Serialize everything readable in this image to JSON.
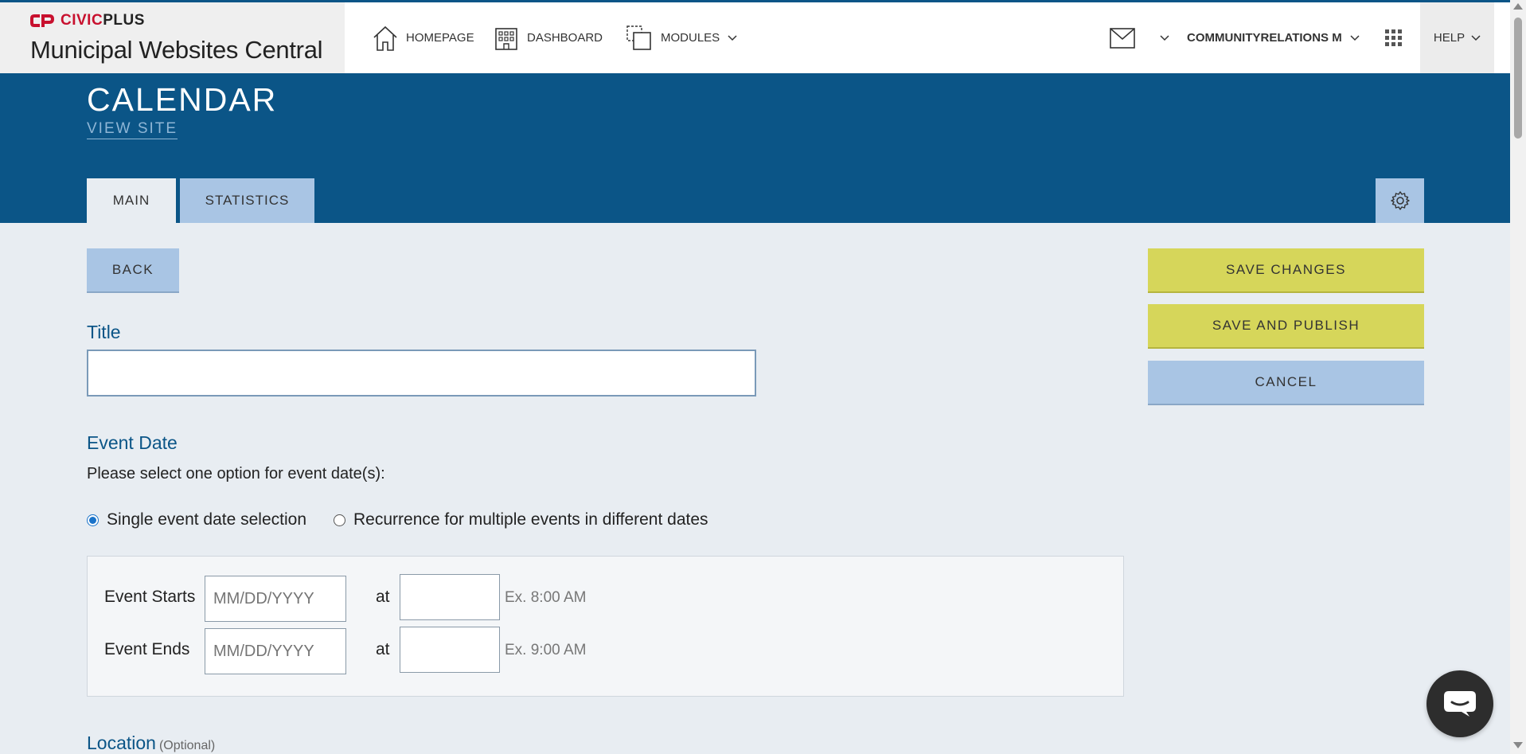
{
  "brand": {
    "logo_part1": "CIVIC",
    "logo_part2": "PLUS",
    "site_name": "Municipal Websites Central",
    "accent_color": "#c8102e"
  },
  "nav": {
    "homepage": "HOMEPAGE",
    "dashboard": "DASHBOARD",
    "modules": "MODULES",
    "user": "COMMUNITYRELATIONS M",
    "help": "HELP"
  },
  "header": {
    "title": "CALENDAR",
    "view_site": "VIEW SITE",
    "bg_color": "#0b5587"
  },
  "tabs": [
    {
      "label": "MAIN",
      "active": true
    },
    {
      "label": "STATISTICS",
      "active": false
    }
  ],
  "buttons": {
    "back": "BACK",
    "save_changes": "SAVE CHANGES",
    "save_publish": "SAVE AND PUBLISH",
    "cancel": "CANCEL"
  },
  "form": {
    "title_label": "Title",
    "title_value": "",
    "event_date_label": "Event Date",
    "instruction": "Please select one option for event date(s):",
    "radio_single": "Single event date selection",
    "radio_recurrence": "Recurrence for multiple events in different dates",
    "event_starts_label": "Event Starts",
    "event_ends_label": "Event Ends",
    "date_placeholder": "MM/DD/YYYY",
    "at_label": "at",
    "start_time_hint": "Ex. 8:00 AM",
    "end_time_hint": "Ex. 9:00 AM",
    "location_label": "Location",
    "location_optional": "(Optional)"
  }
}
